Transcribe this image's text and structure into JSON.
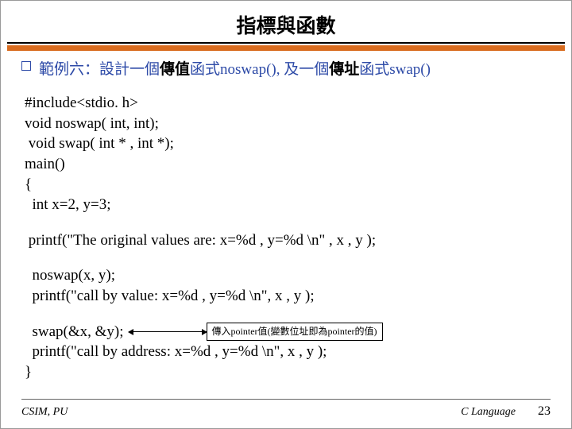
{
  "title": "指標與函數",
  "bullet": {
    "prefix": "範例六：設計一個",
    "bold1": "傳值",
    "mid1": "函式noswap(), 及一個",
    "bold2": "傳址",
    "suffix": "函式swap()"
  },
  "code": {
    "l1": "#include<stdio. h>",
    "l2": "void noswap( int, int);",
    "l3": " void swap( int * , int *);",
    "l4": "main()",
    "l5": "{",
    "l6": "  int x=2, y=3;",
    "l7": " printf(\"The original values are: x=%d , y=%d \\n\" , x , y );",
    "l8": "  noswap(x, y);",
    "l9": "  printf(\"call by value: x=%d , y=%d \\n\", x , y );",
    "l10a": "  swap(&x, &y);",
    "l11": "  printf(\"call by address: x=%d , y=%d \\n\", x , y );",
    "l12": "}"
  },
  "annotation": "傳入pointer值(變數位址即為pointer的值)",
  "footer": {
    "left": "CSIM, PU",
    "right": "C Language",
    "page": "23"
  }
}
